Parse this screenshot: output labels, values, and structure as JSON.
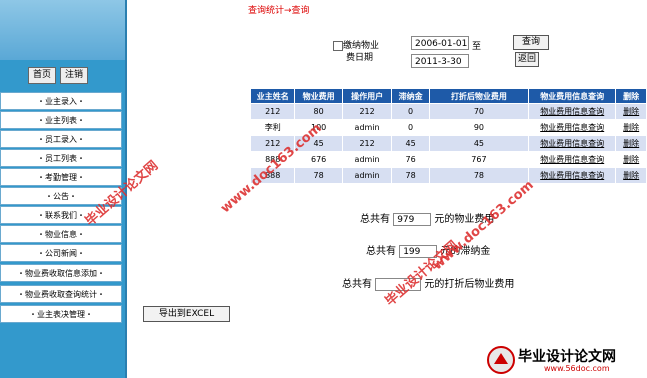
{
  "breadcrumb": "查询统计→查询",
  "nav": {
    "home": "首页",
    "logout": "注销"
  },
  "sidebar": {
    "items": [
      "・业主录入・",
      "・业主列表・",
      "・员工录入・",
      "・员工列表・",
      "・考勤管理・",
      "・公告・",
      "・联系我们・",
      "・物业信息・",
      "・公司新闻・",
      "・物业费收取信息添加・",
      "・物业费收取查询统计・",
      "・业主表决管理・"
    ]
  },
  "filter": {
    "checkbox_label_1": "缴纳物业",
    "checkbox_label_2": "费日期",
    "date_from": "2006-01-01",
    "to_label": "至",
    "date_to": "2011-3-30",
    "query": "查询",
    "back": "返回"
  },
  "table": {
    "headers": [
      "业主姓名",
      "物业费用",
      "操作用户",
      "滞纳金",
      "打折后物业费用",
      "物业费用信息查询",
      "删除"
    ],
    "rows": [
      [
        "212",
        "80",
        "212",
        "0",
        "70",
        "物业费用信息查询",
        "删除"
      ],
      [
        "李利",
        "100",
        "admin",
        "0",
        "90",
        "物业费用信息查询",
        "删除"
      ],
      [
        "212",
        "45",
        "212",
        "45",
        "45",
        "物业费用信息查询",
        "删除"
      ],
      [
        "888",
        "676",
        "admin",
        "76",
        "767",
        "物业费用信息查询",
        "删除"
      ],
      [
        "888",
        "78",
        "admin",
        "78",
        "78",
        "物业费用信息查询",
        "删除"
      ]
    ]
  },
  "summary": {
    "s1_pre": "总共有",
    "s1_val": "979",
    "s1_post": "元的物业费用",
    "s2_pre": "总共有",
    "s2_val": "199",
    "s2_post": "元的滞纳金",
    "s3_pre": "总共有",
    "s3_val": "",
    "s3_post": "元的打折后物业费用"
  },
  "export": "导出到EXCEL",
  "watermarks": [
    "www.doc163.com",
    "毕业设计论文网",
    "www.doc163.com",
    "毕业设计论文网"
  ],
  "logo": {
    "title": "毕业设计论文网",
    "url": "www.56doc.com"
  }
}
